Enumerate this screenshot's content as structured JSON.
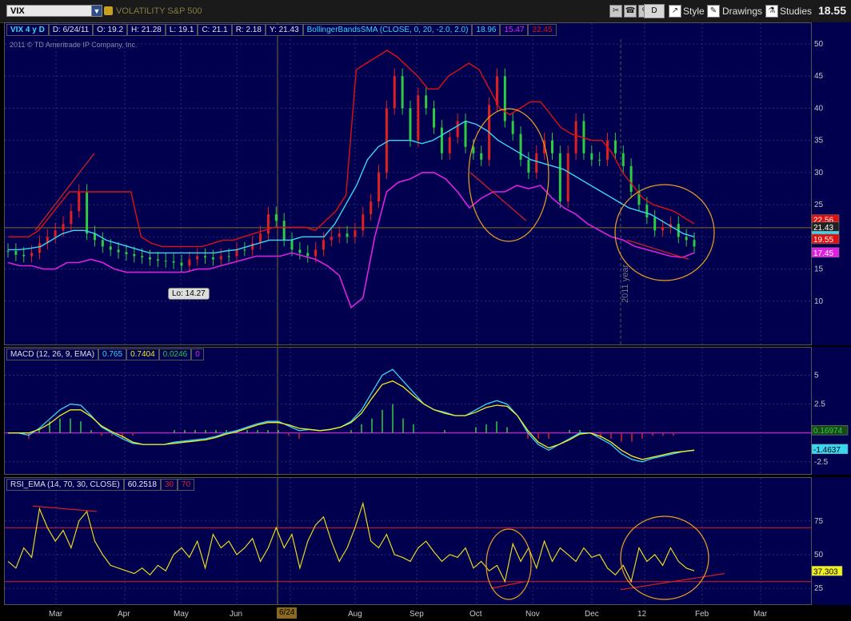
{
  "toolbar": {
    "symbol": "VIX",
    "description": "VOLATILITY S&P 500",
    "drawing_mode": "D",
    "style_label": "Style",
    "drawings_label": "Drawings",
    "studies_label": "Studies",
    "last_price": "18.55"
  },
  "price_pane": {
    "header": {
      "period": "VIX 4 y D",
      "date": "D: 6/24/11",
      "open": "O: 19.2",
      "high": "H: 21.28",
      "low": "L: 19.1",
      "close": "C: 21.1",
      "range": "R: 2.18",
      "y": "Y: 21.43",
      "study": "BollingerBandsSMA (CLOSE, 0, 20, -2.0, 2.0)",
      "study_v1": "18.96",
      "study_v2": "15.47",
      "study_v3": "22.45"
    },
    "copyright": "2011 © TD Ameritrade IP Company, Inc.",
    "low_label": "Lo: 14.27",
    "year_label": "2011 year",
    "badges": [
      "22.56",
      "21.43",
      "20.01",
      "19.55",
      "17.45"
    ]
  },
  "macd_pane": {
    "header": {
      "study": "MACD (12, 26, 9, EMA)",
      "v1": "0.765",
      "v2": "0.7404",
      "v3": "0.0246",
      "v4": "0"
    },
    "badges": [
      "0.16974",
      "-1.4637"
    ]
  },
  "rsi_pane": {
    "header": {
      "study": "RSI_EMA (14, 70, 30, CLOSE)",
      "v1": "60.2518",
      "v2": "30",
      "v3": "70"
    },
    "badge": "37.303"
  },
  "x_labels": [
    "Mar",
    "Apr",
    "May",
    "Jun",
    "6/24",
    "Aug",
    "Sep",
    "Oct",
    "Nov",
    "Dec",
    "12",
    "Feb",
    "Mar"
  ],
  "colors": {
    "pane_bg": "#00004f",
    "candle_up": "#2ecc40",
    "candle_down": "#e02020",
    "upper_band": "#e01010",
    "middle_band": "#3ad6f0",
    "lower_band": "#e020e0",
    "rsi_line": "#e8d820",
    "annotation_circle": "#f0a020"
  },
  "chart_data": [
    {
      "type": "line",
      "title": "VIX 4 y D",
      "series": [
        {
          "name": "Close",
          "values": [
            17.8,
            17.2,
            17.0,
            17.5,
            19.0,
            20.0,
            21.0,
            22.0,
            24.0,
            27.0,
            20.5,
            19.5,
            18.5,
            18.0,
            17.6,
            17.3,
            17.0,
            16.8,
            16.5,
            16.3,
            16.2,
            16.0,
            15.5,
            16.5,
            17.0,
            16.8,
            16.5,
            17.0,
            17.0,
            18.0,
            18.0,
            19.0,
            20.5,
            23.5,
            22.5,
            19.5,
            18.0,
            17.5,
            17.0,
            18.0,
            19.5,
            20.0,
            20.5,
            20.0,
            21.0,
            23.5,
            25.5,
            30.0,
            40.0,
            45.0,
            40.0,
            35.0,
            42.0,
            40.0,
            37.0,
            33.0,
            35.5,
            38.0,
            34.0,
            33.0,
            32.0,
            40.5,
            45.0,
            38.0,
            36.0,
            32.0,
            30.0,
            33.0,
            35.0,
            33.0,
            25.5,
            33.0,
            38.0,
            33.0,
            32.0,
            32.0,
            35.0,
            33.0,
            31.0,
            27.0,
            25.0,
            23.0,
            21.0,
            21.5,
            22.0,
            20.0,
            19.5,
            18.5
          ]
        },
        {
          "name": "Upper Band",
          "values": [
            20.0,
            20.0,
            20.0,
            21.0,
            23.0,
            25.0,
            27.0,
            27.0,
            27.0,
            27.0,
            27.0,
            27.0,
            27.0,
            20.0,
            19.0,
            18.5,
            18.5,
            18.5,
            18.5,
            18.5,
            19.0,
            19.5,
            19.5,
            20.0,
            20.5,
            21.0,
            21.5,
            21.5,
            21.5,
            21.5,
            21.0,
            22.5,
            24.0,
            26.5,
            46.0,
            47.0,
            48.0,
            49.0,
            48.0,
            46.5,
            45.0,
            43.0,
            43.0,
            45.0,
            46.0,
            47.0,
            46.0,
            43.0,
            40.0,
            39.0,
            40.0,
            41.0,
            41.0,
            39.0,
            37.0,
            36.0,
            35.5,
            35.0,
            35.0,
            33.0,
            30.0,
            28.0,
            26.0,
            25.0,
            24.5,
            24.0,
            23.0,
            22.0
          ]
        },
        {
          "name": "Middle Band",
          "values": [
            18.0,
            18.0,
            18.2,
            18.5,
            19.5,
            20.5,
            21.0,
            21.0,
            20.5,
            19.5,
            19.0,
            18.5,
            18.0,
            17.5,
            17.5,
            17.5,
            17.5,
            17.5,
            17.5,
            17.5,
            17.8,
            18.0,
            18.5,
            19.0,
            19.5,
            19.5,
            19.5,
            20.0,
            20.0,
            20.0,
            22.0,
            25.0,
            28.0,
            32.0,
            34.0,
            35.0,
            35.0,
            35.0,
            34.5,
            35.0,
            36.0,
            37.0,
            38.0,
            37.5,
            36.5,
            35.0,
            34.0,
            33.0,
            32.0,
            31.5,
            31.0,
            30.5,
            29.5,
            28.5,
            27.5,
            26.5,
            25.5,
            24.5,
            24.0,
            23.5,
            22.5,
            21.5,
            20.5,
            20.0
          ]
        },
        {
          "name": "Lower Band",
          "values": [
            16.0,
            15.5,
            15.5,
            15.0,
            15.0,
            16.0,
            16.0,
            16.5,
            16.0,
            15.0,
            14.5,
            14.5,
            14.5,
            14.5,
            14.5,
            14.5,
            15.0,
            15.0,
            15.5,
            16.0,
            16.5,
            17.0,
            17.0,
            17.0,
            17.5,
            17.0,
            16.5,
            15.5,
            14.0,
            9.0,
            10.5,
            20.0,
            27.0,
            28.5,
            29.0,
            30.0,
            30.0,
            29.0,
            27.0,
            24.5,
            26.0,
            27.0,
            27.0,
            28.0,
            27.5,
            28.0,
            26.0,
            24.5,
            23.5,
            22.0,
            21.0,
            20.0,
            19.5,
            18.5,
            18.0,
            17.5,
            17.0,
            16.8,
            17.5
          ]
        }
      ],
      "ylim": [
        5,
        50
      ],
      "yticks": [
        10,
        15,
        20,
        25,
        30,
        35,
        40,
        45,
        50
      ],
      "grid": true
    },
    {
      "type": "line",
      "title": "MACD (12, 26, 9, EMA)",
      "series": [
        {
          "name": "MACD",
          "values": [
            0.0,
            0.0,
            -0.2,
            0.4,
            1.2,
            2.0,
            2.5,
            2.4,
            1.5,
            0.5,
            0.0,
            -0.5,
            -0.9,
            -1.0,
            -1.0,
            -1.0,
            -0.8,
            -0.7,
            -0.6,
            -0.5,
            -0.3,
            0.0,
            0.2,
            0.5,
            0.8,
            1.0,
            1.0,
            0.6,
            0.2,
            0.3,
            0.2,
            0.3,
            0.5,
            1.0,
            2.0,
            3.5,
            5.0,
            5.5,
            4.5,
            3.5,
            2.5,
            2.0,
            1.8,
            1.5,
            1.5,
            2.0,
            2.5,
            2.8,
            2.5,
            1.5,
            0.0,
            -1.0,
            -1.5,
            -1.0,
            -0.5,
            0.0,
            0.0,
            -0.5,
            -1.0,
            -1.8,
            -2.3,
            -2.5,
            -2.2,
            -2.0,
            -1.8,
            -1.6,
            -1.5
          ]
        },
        {
          "name": "Signal",
          "values": [
            0.0,
            0.0,
            0.0,
            0.3,
            0.8,
            1.5,
            2.0,
            2.0,
            1.4,
            0.6,
            0.1,
            -0.3,
            -0.8,
            -1.0,
            -1.0,
            -1.0,
            -0.9,
            -0.8,
            -0.7,
            -0.6,
            -0.4,
            -0.1,
            0.1,
            0.4,
            0.7,
            0.9,
            0.9,
            0.7,
            0.4,
            0.3,
            0.2,
            0.3,
            0.5,
            0.9,
            1.7,
            3.0,
            4.2,
            4.5,
            4.0,
            3.2,
            2.5,
            2.0,
            1.7,
            1.5,
            1.5,
            1.8,
            2.2,
            2.4,
            2.3,
            1.5,
            0.2,
            -0.8,
            -1.3,
            -1.0,
            -0.6,
            -0.1,
            0.0,
            -0.3,
            -0.8,
            -1.5,
            -2.0,
            -2.3,
            -2.1,
            -1.9,
            -1.7,
            -1.6,
            -1.5
          ]
        }
      ],
      "ylim": [
        -3,
        6
      ],
      "yticks": [
        -2.5,
        2.5,
        5
      ],
      "grid": true
    },
    {
      "type": "line",
      "title": "RSI_EMA (14, 70, 30, CLOSE)",
      "series": [
        {
          "name": "RSI",
          "values": [
            45,
            40,
            55,
            48,
            84,
            70,
            60,
            68,
            55,
            75,
            82,
            60,
            50,
            42,
            40,
            38,
            36,
            40,
            35,
            42,
            38,
            50,
            55,
            48,
            60,
            40,
            65,
            55,
            60,
            50,
            55,
            62,
            45,
            55,
            70,
            55,
            65,
            40,
            60,
            72,
            78,
            60,
            45,
            55,
            70,
            88,
            60,
            55,
            65,
            50,
            48,
            45,
            55,
            60,
            52,
            45,
            50,
            48,
            55,
            40,
            45,
            38,
            42,
            30,
            58,
            45,
            55,
            40,
            60,
            45,
            55,
            50,
            45,
            55,
            48,
            50,
            40,
            35,
            42,
            30,
            55,
            45,
            50,
            42,
            55,
            45,
            40,
            38
          ]
        }
      ],
      "ylim": [
        15,
        95
      ],
      "yticks": [
        25,
        50,
        75
      ],
      "reference_lines": [
        30,
        70
      ],
      "grid": true
    }
  ]
}
